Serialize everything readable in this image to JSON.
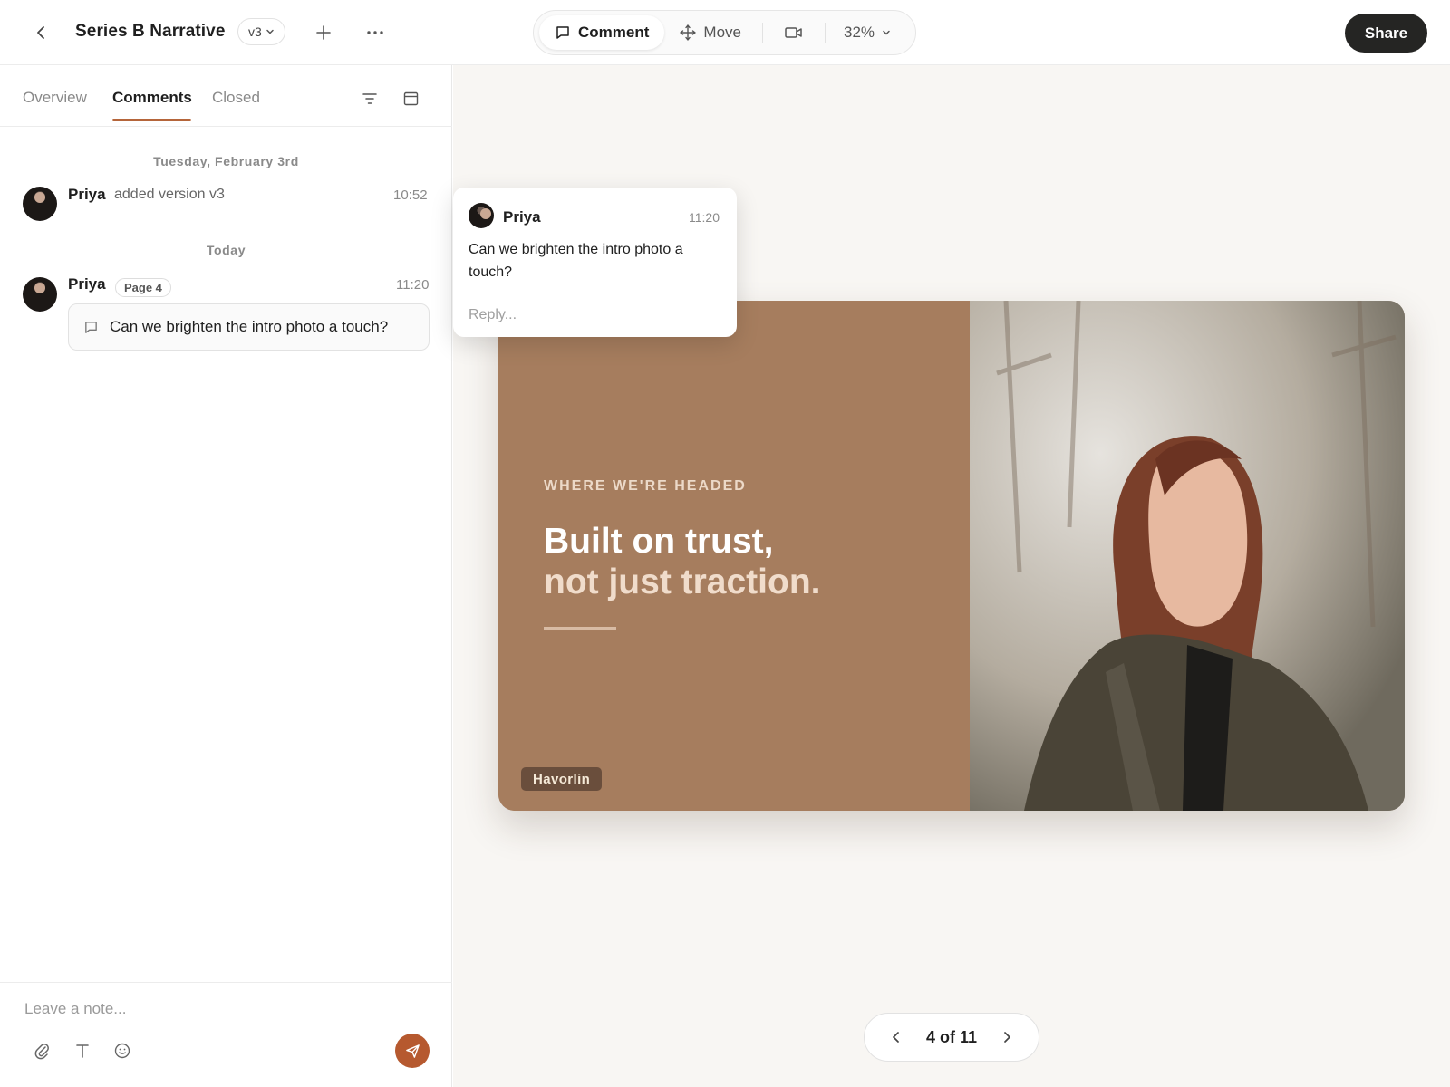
{
  "header": {
    "title": "Series B Narrative",
    "version": "v3",
    "modes": {
      "comment": "Comment",
      "move": "Move"
    },
    "zoom": "32%",
    "share_label": "Share"
  },
  "sidebar": {
    "tabs": [
      {
        "label": "Overview",
        "active": false
      },
      {
        "label": "Comments",
        "active": true
      },
      {
        "label": "Closed",
        "active": false
      }
    ],
    "activity": [
      {
        "day": "Tuesday, February 3rd",
        "author": "Priya",
        "text": "added version v3",
        "time": "10:52"
      },
      {
        "day": "Today",
        "author": "Priya",
        "page": "Page 4",
        "time": "11:20",
        "comment": "Can we brighten the intro photo a touch?"
      }
    ],
    "compose": {
      "placeholder": "Leave a note..."
    }
  },
  "slide": {
    "eyebrow": "WHERE WE'RE HEADED",
    "headline": "Built on trust,",
    "subhead": "not just traction.",
    "brand": "Havorlin",
    "background": "#a67d5e"
  },
  "popover": {
    "author": "Priya",
    "time": "11:20",
    "text": "Can we brighten the intro photo a touch?",
    "reply_placeholder": "Reply..."
  },
  "pager": {
    "label": "4 of 11"
  },
  "colors": {
    "accent": "#b6592f",
    "share_bg": "#252523",
    "tab_underline": "#b5653a"
  }
}
